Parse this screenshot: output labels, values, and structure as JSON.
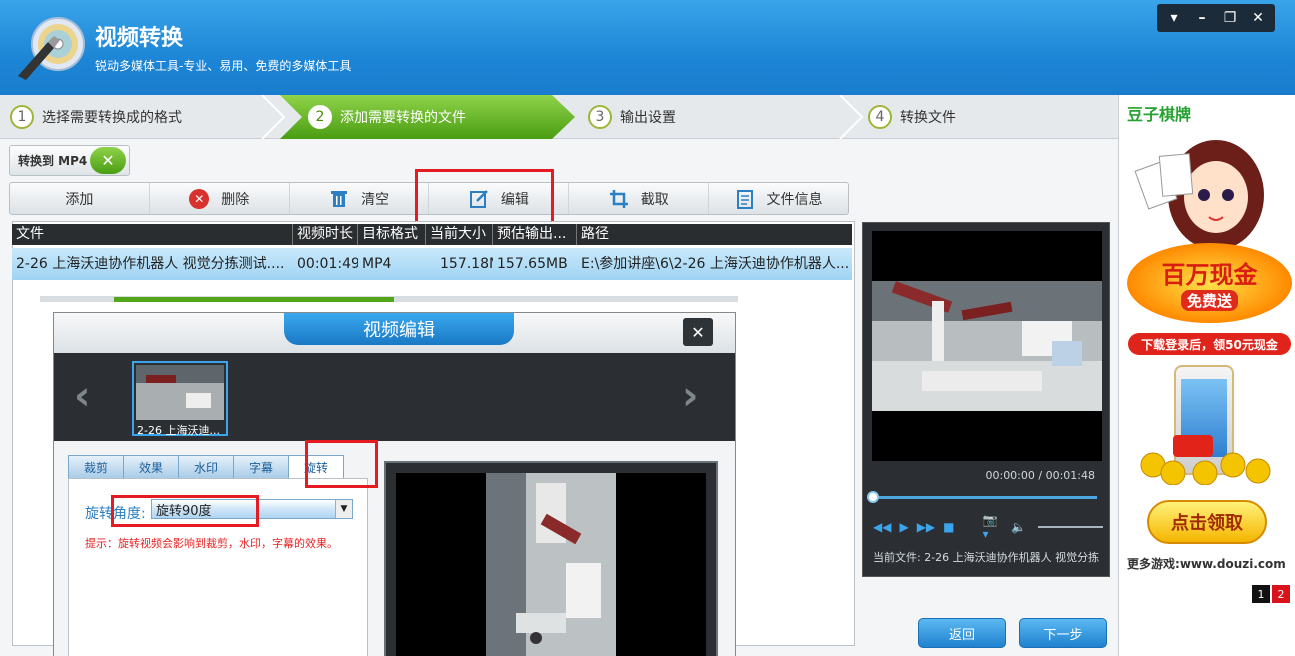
{
  "app": {
    "title": "视频转换",
    "subtitle": "锐动多媒体工具-专业、易用、免费的多媒体工具"
  },
  "window_controls": [
    "▾",
    "–",
    "❐",
    "✕"
  ],
  "steps": [
    {
      "num": "1",
      "label": "选择需要转换成的格式"
    },
    {
      "num": "2",
      "label": "添加需要转换的文件"
    },
    {
      "num": "3",
      "label": "输出设置"
    },
    {
      "num": "4",
      "label": "转换文件"
    }
  ],
  "convert_button": {
    "label": "转换到 MP4"
  },
  "toolbar": {
    "add": "添加",
    "delete": "删除",
    "clear": "清空",
    "edit": "编辑",
    "crop": "截取",
    "fileinfo": "文件信息"
  },
  "table": {
    "headers": [
      "文件",
      "视频时长",
      "目标格式",
      "当前大小",
      "预估输出...",
      "路径"
    ],
    "rows": [
      [
        "2-26 上海沃迪协作机器人 视觉分拣测试....",
        "00:01:49",
        "MP4",
        "157.18MB",
        "157.65MB",
        "E:\\参加讲座\\6\\2-26 上海沃迪协作机器人..."
      ]
    ]
  },
  "preview": {
    "time": "00:00:00 / 00:01:48",
    "current_file": "当前文件: 2-26 上海沃迪协作机器人 视觉分拣"
  },
  "nav": {
    "back": "返回",
    "next": "下一步"
  },
  "dialog": {
    "title": "视频编辑",
    "close": "✕",
    "thumb_caption": "2-26 上海沃迪...",
    "tabs": [
      "裁剪",
      "效果",
      "水印",
      "字幕",
      "旋转"
    ],
    "rotate_label": "旋转角度:",
    "rotate_value": "旋转90度",
    "tip": "提示：旋转视频会影响到裁剪，水印，字幕的效果。"
  },
  "ad": {
    "brand": "豆子棋牌",
    "banner_main": "百万现金",
    "banner_sub": "免费送",
    "red_text": "下载登录后，领50元现金",
    "cta": "点击领取",
    "more_label": "更多游戏:",
    "more_url": "www.douzi.com",
    "pages": [
      "1",
      "2"
    ]
  },
  "colors": {
    "header_blue": "#1d86d6",
    "step_active_green": "#5cb318",
    "highlight_red": "#e51b23",
    "row_selected": "#9fd3f3"
  }
}
